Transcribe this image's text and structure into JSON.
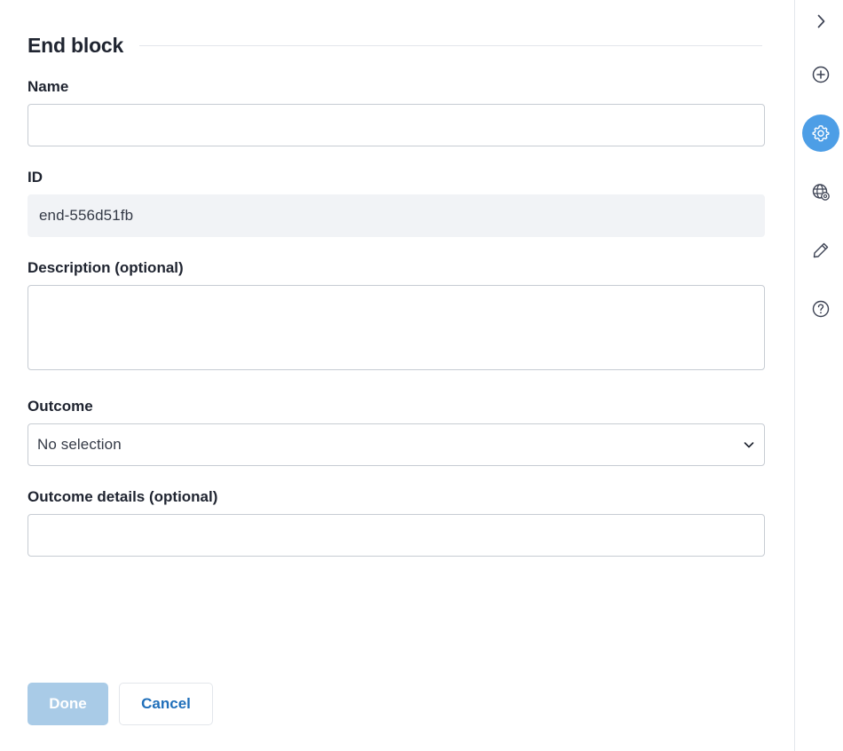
{
  "panel": {
    "title": "End block"
  },
  "form": {
    "name": {
      "label": "Name",
      "value": "",
      "placeholder": ""
    },
    "id": {
      "label": "ID",
      "value": "end-556d51fb"
    },
    "description": {
      "label": "Description (optional)",
      "value": "",
      "placeholder": ""
    },
    "outcome": {
      "label": "Outcome",
      "selected": "No selection"
    },
    "outcome_details": {
      "label": "Outcome details (optional)",
      "value": "",
      "placeholder": ""
    }
  },
  "actions": {
    "done_label": "Done",
    "cancel_label": "Cancel"
  },
  "rail": {
    "items": [
      {
        "icon": "chevron-right-icon",
        "active": false
      },
      {
        "icon": "plus-circle-icon",
        "active": false
      },
      {
        "icon": "gear-icon",
        "active": true
      },
      {
        "icon": "globe-gear-icon",
        "active": false
      },
      {
        "icon": "pencil-icon",
        "active": false
      },
      {
        "icon": "help-circle-icon",
        "active": false
      }
    ]
  },
  "colors": {
    "accent": "#4d9ee6",
    "done_disabled_bg": "#a9cbe7",
    "cancel_text": "#1f6fba",
    "readonly_bg": "#f1f3f6",
    "border": "#c7ccd3"
  }
}
